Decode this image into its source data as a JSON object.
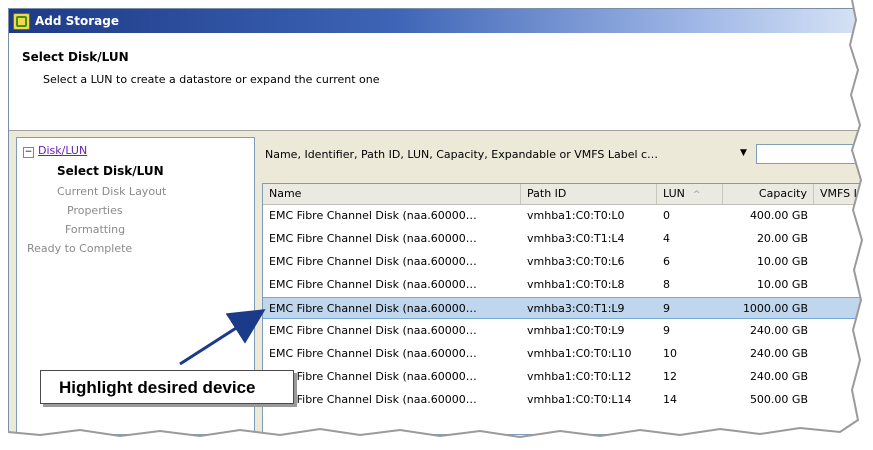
{
  "window": {
    "title": "Add Storage"
  },
  "header": {
    "title": "Select Disk/LUN",
    "subtitle": "Select a LUN to create a datastore or expand the current one"
  },
  "nav": {
    "toggle": "−",
    "root_link": "Disk/LUN",
    "items": [
      {
        "label": "Select Disk/LUN",
        "state": "selected"
      },
      {
        "label": "Current Disk Layout",
        "state": "disabled"
      },
      {
        "label": "Properties",
        "state": "disabled"
      },
      {
        "label": "Formatting",
        "state": "disabled"
      },
      {
        "label": "Ready to Complete",
        "state": "disabled"
      }
    ]
  },
  "filter": {
    "label": "Name, Identifier, Path ID, LUN, Capacity, Expandable or VMFS Label c…",
    "dropdown_icon": "chevron-down-icon",
    "value": ""
  },
  "table": {
    "columns": [
      "Name",
      "Path ID",
      "LUN",
      "Capacity",
      "VMFS La"
    ],
    "sort_indicator": "^",
    "rows": [
      {
        "name": "EMC Fibre Channel Disk (naa.60000…",
        "path": "vmhba1:C0:T0:L0",
        "lun": "0",
        "capacity": "400.00 GB",
        "selected": false
      },
      {
        "name": "EMC Fibre Channel Disk (naa.60000…",
        "path": "vmhba3:C0:T1:L4",
        "lun": "4",
        "capacity": "20.00 GB",
        "selected": false
      },
      {
        "name": "EMC Fibre Channel Disk (naa.60000…",
        "path": "vmhba3:C0:T0:L6",
        "lun": "6",
        "capacity": "10.00 GB",
        "selected": false
      },
      {
        "name": "EMC Fibre Channel Disk (naa.60000…",
        "path": "vmhba1:C0:T0:L8",
        "lun": "8",
        "capacity": "10.00 GB",
        "selected": false
      },
      {
        "name": "EMC Fibre Channel Disk (naa.60000…",
        "path": "vmhba3:C0:T1:L9",
        "lun": "9",
        "capacity": "1000.00 GB",
        "selected": true
      },
      {
        "name": "EMC Fibre Channel Disk (naa.60000…",
        "path": "vmhba1:C0:T0:L9",
        "lun": "9",
        "capacity": "240.00 GB",
        "selected": false
      },
      {
        "name": "EMC Fibre Channel Disk (naa.60000…",
        "path": "vmhba1:C0:T0:L10",
        "lun": "10",
        "capacity": "240.00 GB",
        "selected": false
      },
      {
        "name": "EMC Fibre Channel Disk (naa.60000…",
        "path": "vmhba1:C0:T0:L12",
        "lun": "12",
        "capacity": "240.00 GB",
        "selected": false
      },
      {
        "name": "EMC Fibre Channel Disk (naa.60000…",
        "path": "vmhba1:C0:T0:L14",
        "lun": "14",
        "capacity": "500.00 GB",
        "selected": false
      }
    ]
  },
  "callout": {
    "text": "Highlight desired device"
  },
  "colors": {
    "selected_row": "#bfd6ec",
    "arrow": "#1b3a8a",
    "link": "#6a1fb8"
  }
}
